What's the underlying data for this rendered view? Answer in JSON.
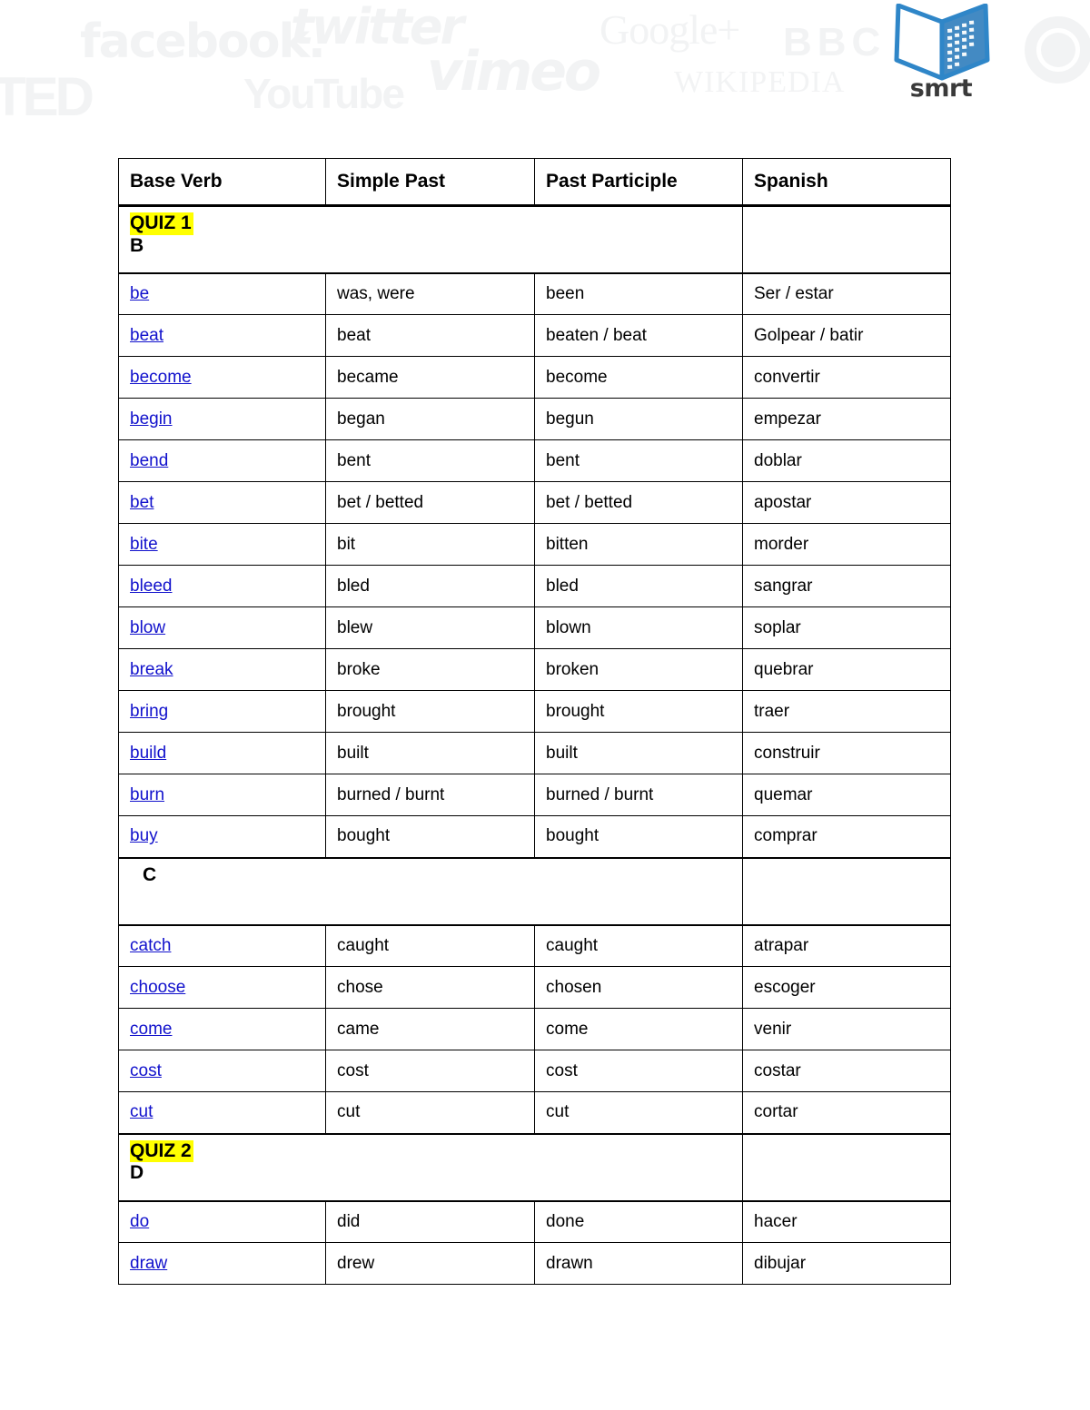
{
  "header": {
    "watermarks": [
      {
        "name": "facebook-watermark",
        "label": "facebook."
      },
      {
        "name": "ted-watermark",
        "label": "TED"
      },
      {
        "name": "twitter-watermark",
        "label": "twitter"
      },
      {
        "name": "youtube-watermark",
        "label": "YouTube"
      },
      {
        "name": "vimeo-watermark",
        "label": "vimeo"
      },
      {
        "name": "googleplus-watermark",
        "label": "Google+"
      },
      {
        "name": "wikipedia-watermark",
        "label": "WIKIPEDIA"
      },
      {
        "name": "bbc-watermark",
        "label": "BBC"
      }
    ],
    "facebook": "facebook.",
    "ted": "TED",
    "twitter": "twitter",
    "youtube": "YouTube",
    "vimeo": "vimeo",
    "googleplus": "Google+",
    "wikipedia": "WIKIPEDIA",
    "bbc": "BBC",
    "logo_word": "smrt",
    "logo_accent_color": "#3d87c8"
  },
  "table": {
    "columns": [
      "Base Verb",
      "Simple Past",
      "Past Participle",
      "Spanish"
    ],
    "highlight_color": "#ffff00",
    "link_color": "#1111cc",
    "rows": [
      {
        "type": "section",
        "quiz": "QUIZ 1",
        "letter": "B",
        "indent": false
      },
      {
        "type": "verb",
        "base": "be",
        "past": "was, were",
        "participle": "been",
        "spanish": "Ser / estar"
      },
      {
        "type": "verb",
        "base": "beat",
        "past": "beat",
        "participle": "beaten / beat",
        "spanish": "Golpear / batir"
      },
      {
        "type": "verb",
        "base": "become",
        "past": "became",
        "participle": "become",
        "spanish": "convertir"
      },
      {
        "type": "verb",
        "base": "begin",
        "past": "began",
        "participle": "begun",
        "spanish": "empezar"
      },
      {
        "type": "verb",
        "base": "bend",
        "past": "bent",
        "participle": "bent",
        "spanish": "doblar"
      },
      {
        "type": "verb",
        "base": "bet",
        "past": "bet / betted",
        "participle": "bet / betted",
        "spanish": "apostar"
      },
      {
        "type": "verb",
        "base": "bite",
        "past": "bit",
        "participle": "bitten",
        "spanish": "morder"
      },
      {
        "type": "verb",
        "base": "bleed",
        "past": "bled",
        "participle": "bled",
        "spanish": "sangrar"
      },
      {
        "type": "verb",
        "base": "blow",
        "past": "blew",
        "participle": "blown",
        "spanish": "soplar"
      },
      {
        "type": "verb",
        "base": "break",
        "past": "broke",
        "participle": "broken",
        "spanish": "quebrar"
      },
      {
        "type": "verb",
        "base": "bring",
        "past": "brought",
        "participle": "brought",
        "spanish": "traer"
      },
      {
        "type": "verb",
        "base": "build",
        "past": "built",
        "participle": "built",
        "spanish": "construir"
      },
      {
        "type": "verb",
        "base": "burn",
        "past": "burned / burnt",
        "participle": "burned / burnt",
        "spanish": "quemar"
      },
      {
        "type": "verb",
        "base": "buy",
        "past": "bought",
        "participle": "bought",
        "spanish": "comprar"
      },
      {
        "type": "section",
        "quiz": "",
        "letter": "C",
        "indent": true
      },
      {
        "type": "verb",
        "base": "catch",
        "past": "caught",
        "participle": "caught",
        "spanish": "atrapar"
      },
      {
        "type": "verb",
        "base": "choose",
        "past": "chose",
        "participle": "chosen",
        "spanish": "escoger"
      },
      {
        "type": "verb",
        "base": "come",
        "past": "came",
        "participle": "come",
        "spanish": "venir"
      },
      {
        "type": "verb",
        "base": "cost",
        "past": "cost",
        "participle": "cost",
        "spanish": "costar"
      },
      {
        "type": "verb",
        "base": "cut",
        "past": "cut",
        "participle": "cut",
        "spanish": "cortar"
      },
      {
        "type": "section",
        "quiz": "QUIZ 2",
        "letter": "D",
        "indent": false
      },
      {
        "type": "verb",
        "base": "do",
        "past": "did",
        "participle": "done",
        "spanish": "hacer"
      },
      {
        "type": "verb",
        "base": "draw",
        "past": "drew",
        "participle": "drawn",
        "spanish": "dibujar"
      }
    ]
  }
}
